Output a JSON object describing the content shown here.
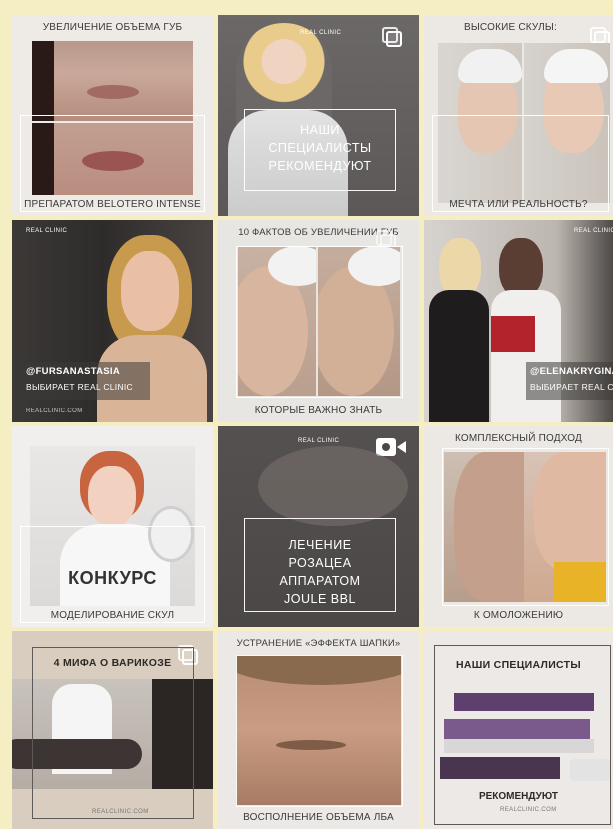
{
  "brand": "REAL CLINIC",
  "brand_url": "REALCLINIC.COM",
  "posts": [
    {
      "top": "УВЕЛИЧЕНИЕ ОБЪЕМА ГУБ",
      "bottom": "ПРЕПАРАТОМ BELOTERO INTENSE"
    },
    {
      "center": [
        "НАШИ",
        "СПЕЦИАЛИСТЫ",
        "РЕКОМЕНДУЮТ"
      ]
    },
    {
      "top": "ВЫСОКИЕ СКУЛЫ:",
      "bottom": "МЕЧТА ИЛИ РЕАЛЬНОСТЬ?"
    },
    {
      "handle": "@FURSANASTASIA",
      "sub": "ВЫБИРАЕТ REAL CLINIC"
    },
    {
      "top": "10 ФАКТОВ ОБ УВЕЛИЧЕНИИ ГУБ",
      "bottom": "КОТОРЫЕ ВАЖНО ЗНАТЬ"
    },
    {
      "handle": "@ELENAKRYGINA",
      "sub": "ВЫБИРАЕТ REAL CLINIC"
    },
    {
      "center": "КОНКУРС",
      "bottom": "МОДЕЛИРОВАНИЕ СКУЛ"
    },
    {
      "center": [
        "ЛЕЧЕНИЕ",
        "РОЗАЦЕА",
        "АППАРАТОМ",
        "JOULE BBL"
      ]
    },
    {
      "top": "КОМПЛЕКСНЫЙ ПОДХОД",
      "bottom": "К ОМОЛОЖЕНИЮ"
    },
    {
      "top": "4 МИФА О ВАРИКОЗЕ"
    },
    {
      "top": "УСТРАНЕНИЕ «ЭФФЕКТА ШАПКИ»",
      "bottom": "ВОСПОЛНЕНИЕ ОБЪЕМА ЛБА"
    },
    {
      "top": "НАШИ СПЕЦИАЛИСТЫ",
      "bottom": "РЕКОМЕНДУЮТ"
    }
  ],
  "icons": {
    "carousel": "carousel-icon",
    "video": "video-camera-icon"
  }
}
